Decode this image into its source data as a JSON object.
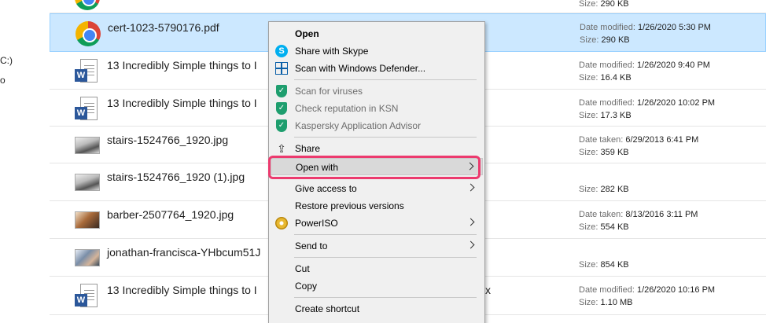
{
  "nav_fragments": [
    "C:)",
    "o"
  ],
  "files": [
    {
      "name": "",
      "icon": "chrome-icon",
      "meta1_label": "",
      "meta1_value": "",
      "meta2_label": "Size:",
      "meta2_value": "290 KB"
    },
    {
      "name": "cert-1023-5790176.pdf",
      "icon": "chrome-icon",
      "meta1_label": "Date modified:",
      "meta1_value": "1/26/2020 5:30 PM",
      "meta2_label": "Size:",
      "meta2_value": "290 KB"
    },
    {
      "name": "13 Incredibly Simple things to I",
      "icon": "word-icon",
      "meta1_label": "Date modified:",
      "meta1_value": "1/26/2020 9:40 PM",
      "meta2_label": "Size:",
      "meta2_value": "16.4 KB"
    },
    {
      "name": "13 Incredibly Simple things to I",
      "icon": "word-icon",
      "meta1_label": "Date modified:",
      "meta1_value": "1/26/2020 10:02 PM",
      "meta2_label": "Size:",
      "meta2_value": "17.3 KB"
    },
    {
      "name": "stairs-1524766_1920.jpg",
      "icon": "photo-icon",
      "meta1_label": "Date taken:",
      "meta1_value": "6/29/2013 6:41 PM",
      "meta2_label": "Size:",
      "meta2_value": "359 KB"
    },
    {
      "name": "stairs-1524766_1920 (1).jpg",
      "icon": "photo-icon",
      "meta1_label": "",
      "meta1_value": "",
      "meta2_label": "Size:",
      "meta2_value": "282 KB"
    },
    {
      "name": "barber-2507764_1920.jpg",
      "icon": "photo-icon",
      "meta1_label": "Date taken:",
      "meta1_value": "8/13/2016 3:11 PM",
      "meta2_label": "Size:",
      "meta2_value": "554 KB"
    },
    {
      "name": "jonathan-francisca-YHbcum51J",
      "icon": "photo-icon",
      "meta1_label": "",
      "meta1_value": "",
      "meta2_label": "Size:",
      "meta2_value": "854 KB"
    },
    {
      "name": "13 Incredibly Simple things to I",
      "name_tail": "x",
      "icon": "word-icon",
      "meta1_label": "Date modified:",
      "meta1_value": "1/26/2020 10:16 PM",
      "meta2_label": "Size:",
      "meta2_value": "1.10 MB"
    }
  ],
  "context_menu": {
    "items": [
      {
        "label": "Open",
        "icon": ""
      },
      {
        "label": "Share with Skype",
        "icon": "skype-icon",
        "icon_glyph": "S"
      },
      {
        "label": "Scan with Windows Defender...",
        "icon": "defender-icon"
      },
      {
        "label": "Scan for viruses",
        "icon": "kaspersky-shield-icon",
        "icon_glyph": "✓"
      },
      {
        "label": "Check reputation in KSN",
        "icon": "kaspersky-shield-icon",
        "icon_glyph": "✓"
      },
      {
        "label": "Kaspersky Application Advisor",
        "icon": "kaspersky-shield-icon",
        "icon_glyph": "✓"
      },
      {
        "label": "Share",
        "icon": "share-icon",
        "icon_glyph": "⇪"
      },
      {
        "label": "Open with",
        "icon": ""
      },
      {
        "label": "Give access to",
        "icon": ""
      },
      {
        "label": "Restore previous versions",
        "icon": ""
      },
      {
        "label": "PowerISO",
        "icon": "poweriso-icon"
      },
      {
        "label": "Send to",
        "icon": ""
      },
      {
        "label": "Cut",
        "icon": ""
      },
      {
        "label": "Copy",
        "icon": ""
      },
      {
        "label": "Create shortcut",
        "icon": ""
      }
    ]
  },
  "colors": {
    "selection": "#cce8ff",
    "highlight": "#ec3a6e",
    "menu_bg": "#f0f0f0",
    "word_blue": "#2b579a",
    "kaspersky_green": "#1e9e6e"
  }
}
